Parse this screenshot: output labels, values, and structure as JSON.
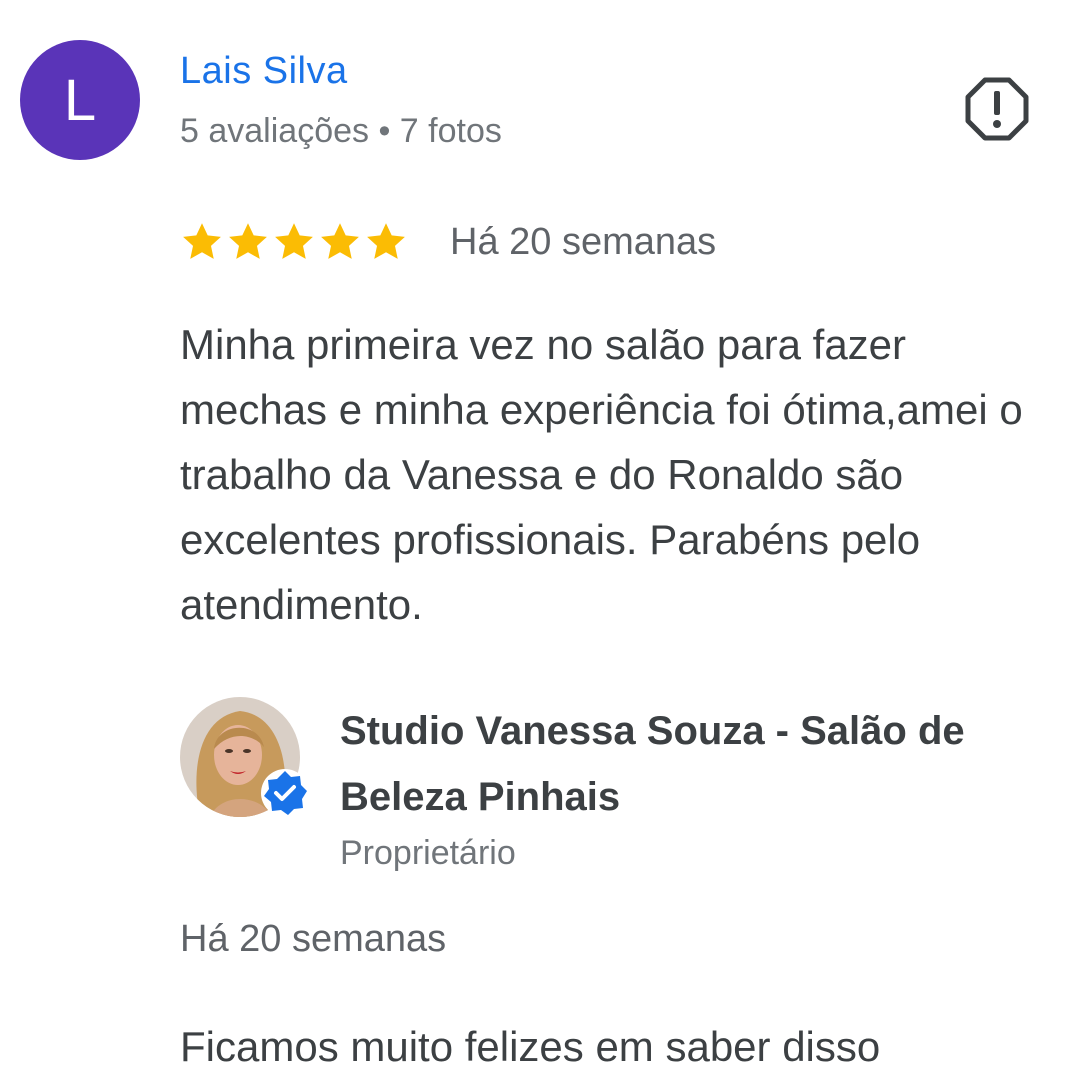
{
  "review": {
    "avatar_letter": "L",
    "avatar_color": "#5a34b8",
    "author": "Lais Silva",
    "meta": "5 avaliações • 7 fotos",
    "rating": 5,
    "rating_max": 5,
    "date": "Há 20 semanas",
    "text": "Minha primeira vez no salão para fazer mechas e minha experiência foi ótima,amei o trabalho da Vanessa e do Ronaldo são excelentes profissionais. Parabéns pelo atendimento.",
    "report_icon": "report-icon"
  },
  "reply": {
    "owner_name": "Studio Vanessa Souza - Salão de Beleza Pinhais",
    "owner_role": "Proprietário",
    "date": "Há 20 semanas",
    "text": "Ficamos muito felizes em saber disso",
    "verified_icon": "verified-badge-icon"
  },
  "colors": {
    "link_blue": "#1a73e8",
    "star_yellow": "#fbbc04",
    "text_gray": "#3c4043",
    "meta_gray": "#70757a"
  }
}
